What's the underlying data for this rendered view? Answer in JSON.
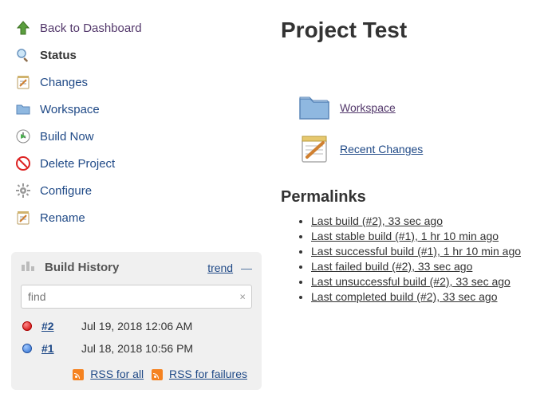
{
  "sidebar": {
    "items": [
      {
        "label": "Back to Dashboard"
      },
      {
        "label": "Status"
      },
      {
        "label": "Changes"
      },
      {
        "label": "Workspace"
      },
      {
        "label": "Build Now"
      },
      {
        "label": "Delete Project"
      },
      {
        "label": "Configure"
      },
      {
        "label": "Rename"
      }
    ]
  },
  "history": {
    "title": "Build History",
    "trend_label": "trend",
    "search_placeholder": "find",
    "builds": [
      {
        "num": "#2",
        "date": "Jul 19, 2018 12:06 AM"
      },
      {
        "num": "#1",
        "date": "Jul 18, 2018 10:56 PM"
      }
    ],
    "rss_all": "RSS for all",
    "rss_failures": "RSS for failures"
  },
  "main": {
    "title": "Project Test",
    "workspace_label": "Workspace",
    "recent_changes_label": "Recent Changes",
    "permalinks_title": "Permalinks",
    "permalinks": [
      "Last build (#2), 33 sec ago",
      "Last stable build (#1), 1 hr 10 min ago",
      "Last successful build (#1), 1 hr 10 min ago",
      "Last failed build (#2), 33 sec ago",
      "Last unsuccessful build (#2), 33 sec ago",
      "Last completed build (#2), 33 sec ago"
    ]
  }
}
